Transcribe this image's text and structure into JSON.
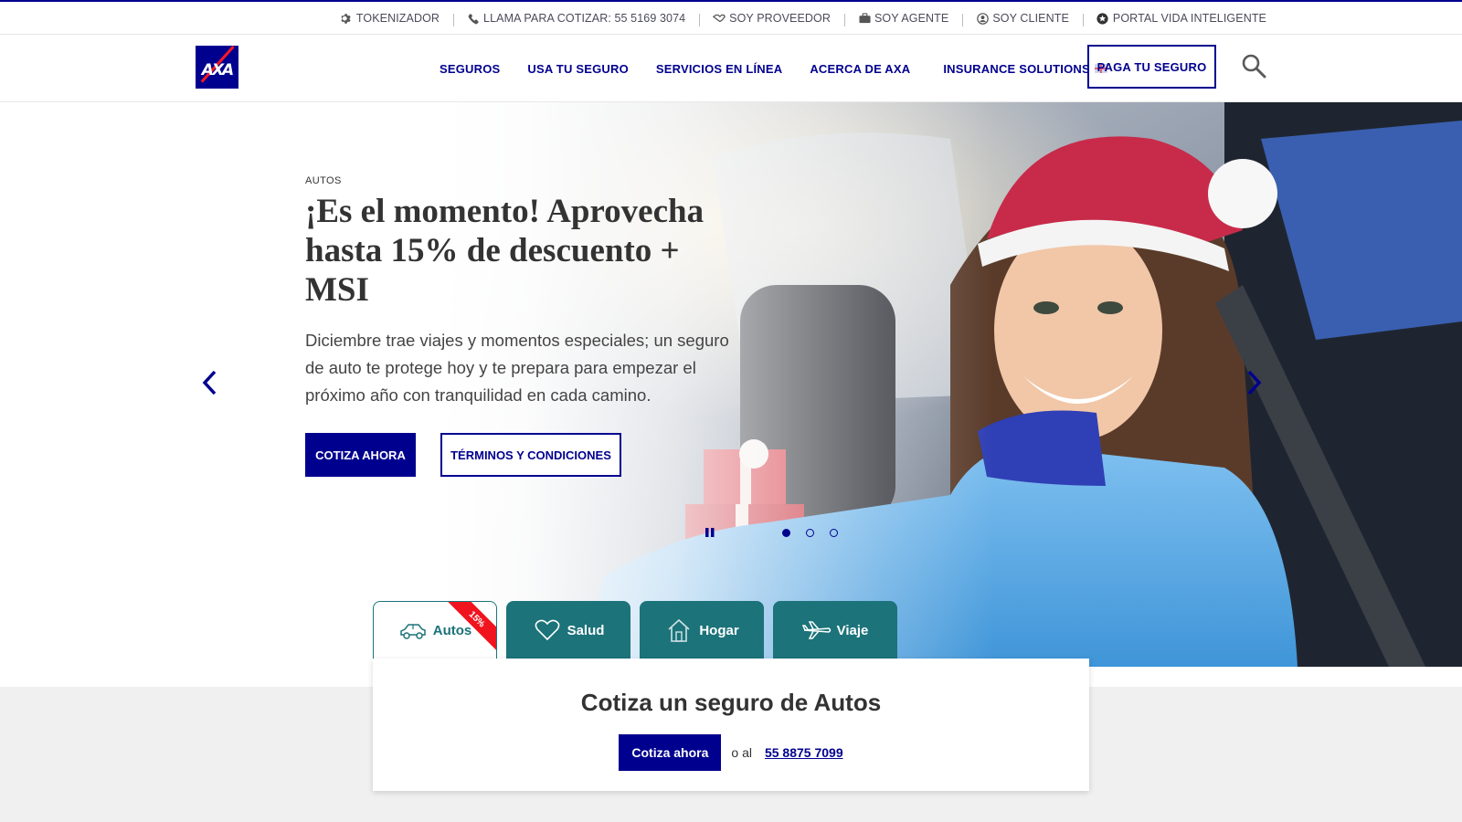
{
  "topbar": {
    "items": [
      {
        "label": "TOKENIZADOR",
        "icon": "gear-icon"
      },
      {
        "label": "LLAMA PARA COTIZAR: 55 5169 3074",
        "icon": "phone-icon"
      },
      {
        "label": "SOY PROVEEDOR",
        "icon": "handshake-icon"
      },
      {
        "label": "SOY AGENTE",
        "icon": "briefcase-icon"
      },
      {
        "label": "SOY CLIENTE",
        "icon": "user-circle-icon"
      },
      {
        "label": "PORTAL VIDA INTELIGENTE",
        "icon": "star-circle-icon"
      }
    ]
  },
  "header": {
    "logo_text": "AXA",
    "nav": [
      "SEGUROS",
      "USA TU SEGURO",
      "SERVICIOS EN LÍNEA",
      "ACERCA DE AXA",
      "INSURANCE SOLUTIONS"
    ],
    "pay_button": "PAGA TU SEGURO"
  },
  "hero": {
    "eyebrow": "AUTOS",
    "title": "¡Es el momento! Aprovecha hasta 15% de descuento + MSI",
    "description": "Diciembre trae viajes y momentos especiales; un seguro de auto te protege hoy y te prepara para empezar el próximo año con tranquilidad en cada camino.",
    "primary_button": "COTIZA AHORA",
    "secondary_button": "TÉRMINOS Y CONDICIONES",
    "slides_total": 3,
    "active_slide": 1
  },
  "tabs": [
    {
      "label": "Autos",
      "icon": "car-icon",
      "active": true,
      "badge": "15%"
    },
    {
      "label": "Salud",
      "icon": "heart-icon",
      "active": false
    },
    {
      "label": "Hogar",
      "icon": "house-icon",
      "active": false
    },
    {
      "label": "Viaje",
      "icon": "airplane-icon",
      "active": false
    }
  ],
  "quote": {
    "title": "Cotiza un seguro de Autos",
    "button": "Cotiza ahora",
    "or_text": "o al",
    "phone": "55 8875 7099"
  },
  "colors": {
    "brand_blue": "#00008f",
    "teal": "#1c737a",
    "ribbon_red": "#f0141e",
    "logo_red": "#ff1721"
  }
}
